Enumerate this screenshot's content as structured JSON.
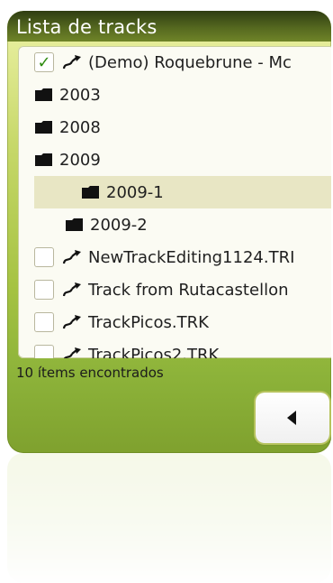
{
  "window": {
    "title": "Lista de tracks"
  },
  "list": {
    "items": [
      {
        "type": "track",
        "checked": true,
        "label": "(Demo) Roquebrune - Mc"
      },
      {
        "type": "folder",
        "label": "2003"
      },
      {
        "type": "folder",
        "label": "2008"
      },
      {
        "type": "folder",
        "label": "2009"
      },
      {
        "type": "folder",
        "label": "2009-1",
        "selected": true
      },
      {
        "type": "folder",
        "label": "2009-2"
      },
      {
        "type": "track",
        "checked": false,
        "label": "NewTrackEditing1124.TRI"
      },
      {
        "type": "track",
        "checked": false,
        "label": "Track from Rutacastellon"
      },
      {
        "type": "track",
        "checked": false,
        "label": "TrackPicos.TRK"
      },
      {
        "type": "track",
        "checked": false,
        "label": "TrackPicos2.TRK"
      }
    ]
  },
  "status": {
    "found_text": "10 ítems encontrados"
  },
  "icons": {
    "check": "checkmark-icon",
    "track": "track-route-icon",
    "folder": "folder-icon",
    "back": "back-arrow-icon"
  },
  "colors": {
    "accent": "#9bbb3c",
    "title_bar": "#4c5e1b",
    "checkmark": "#2e8b10",
    "selected_row": "#e8e6c4"
  }
}
